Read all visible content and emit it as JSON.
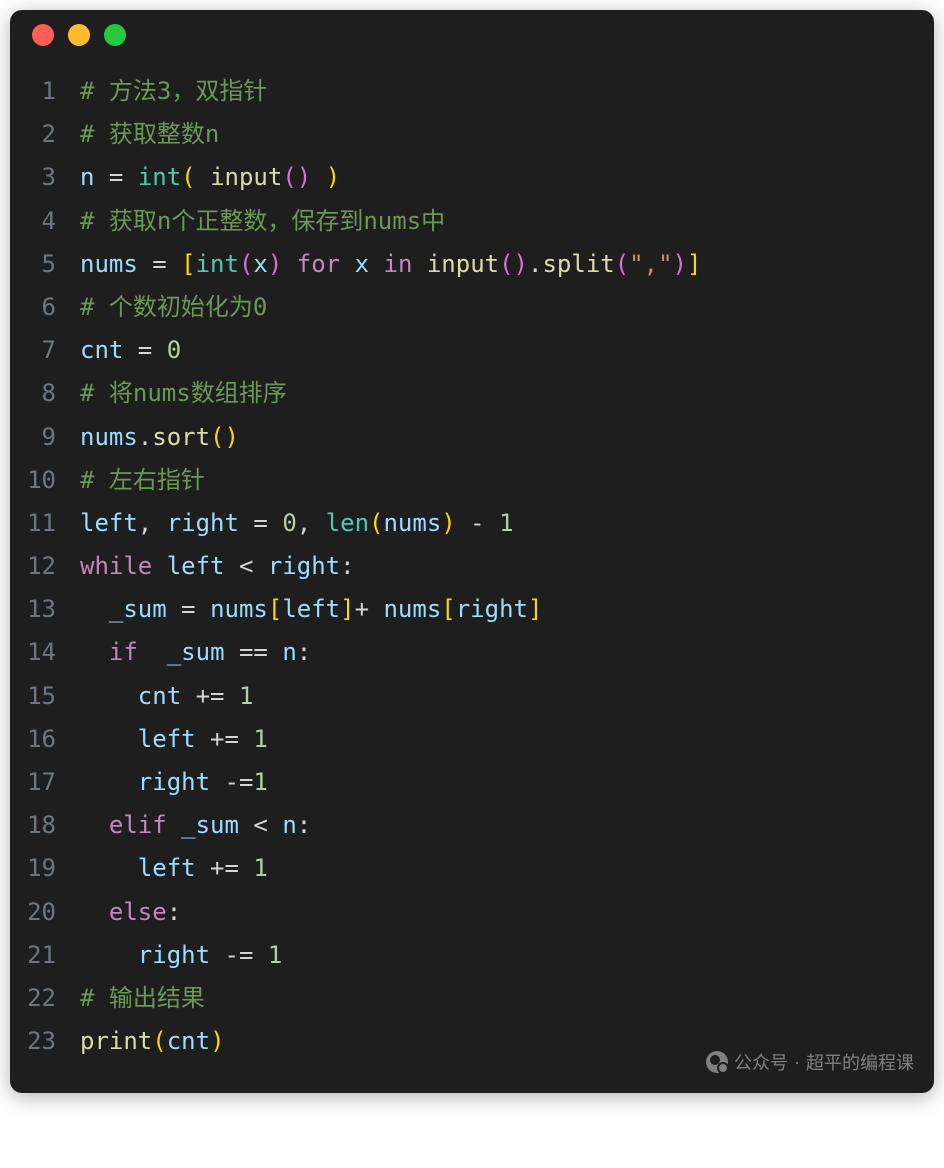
{
  "window": {
    "dots": [
      "red",
      "yellow",
      "green"
    ]
  },
  "watermark": {
    "label": "公众号",
    "sep": "·",
    "name": "超平的编程课"
  },
  "code": {
    "lines": [
      {
        "n": 1,
        "indent": "",
        "tokens": [
          {
            "t": "# 方法3，双指针",
            "c": "comment"
          }
        ]
      },
      {
        "n": 2,
        "indent": "",
        "tokens": [
          {
            "t": "# 获取整数n",
            "c": "comment"
          }
        ]
      },
      {
        "n": 3,
        "indent": "",
        "tokens": [
          {
            "t": "n",
            "c": "ident"
          },
          {
            "t": " = ",
            "c": "op"
          },
          {
            "t": "int",
            "c": "builtin"
          },
          {
            "t": "(",
            "c": "punc"
          },
          {
            "t": " ",
            "c": "op"
          },
          {
            "t": "input",
            "c": "func"
          },
          {
            "t": "()",
            "c": "punc2"
          },
          {
            "t": " ",
            "c": "op"
          },
          {
            "t": ")",
            "c": "punc"
          }
        ]
      },
      {
        "n": 4,
        "indent": "",
        "tokens": [
          {
            "t": "# 获取n个正整数，保存到nums中",
            "c": "comment"
          }
        ]
      },
      {
        "n": 5,
        "indent": "",
        "tokens": [
          {
            "t": "nums",
            "c": "ident"
          },
          {
            "t": " = ",
            "c": "op"
          },
          {
            "t": "[",
            "c": "punc"
          },
          {
            "t": "int",
            "c": "builtin"
          },
          {
            "t": "(",
            "c": "punc2"
          },
          {
            "t": "x",
            "c": "ident"
          },
          {
            "t": ")",
            "c": "punc2"
          },
          {
            "t": " ",
            "c": "op"
          },
          {
            "t": "for",
            "c": "keyword"
          },
          {
            "t": " ",
            "c": "op"
          },
          {
            "t": "x",
            "c": "ident"
          },
          {
            "t": " ",
            "c": "op"
          },
          {
            "t": "in",
            "c": "keyword"
          },
          {
            "t": " ",
            "c": "op"
          },
          {
            "t": "input",
            "c": "func"
          },
          {
            "t": "()",
            "c": "punc2"
          },
          {
            "t": ".",
            "c": "op"
          },
          {
            "t": "split",
            "c": "func"
          },
          {
            "t": "(",
            "c": "punc2"
          },
          {
            "t": "\",\"",
            "c": "string"
          },
          {
            "t": ")",
            "c": "punc2"
          },
          {
            "t": "]",
            "c": "punc"
          }
        ]
      },
      {
        "n": 6,
        "indent": "",
        "tokens": [
          {
            "t": "# 个数初始化为0",
            "c": "comment"
          }
        ]
      },
      {
        "n": 7,
        "indent": "",
        "tokens": [
          {
            "t": "cnt",
            "c": "ident"
          },
          {
            "t": " = ",
            "c": "op"
          },
          {
            "t": "0",
            "c": "number"
          }
        ]
      },
      {
        "n": 8,
        "indent": "",
        "tokens": [
          {
            "t": "# 将nums数组排序",
            "c": "comment"
          }
        ]
      },
      {
        "n": 9,
        "indent": "",
        "tokens": [
          {
            "t": "nums",
            "c": "ident"
          },
          {
            "t": ".",
            "c": "op"
          },
          {
            "t": "sort",
            "c": "func"
          },
          {
            "t": "()",
            "c": "punc"
          }
        ]
      },
      {
        "n": 10,
        "indent": "",
        "tokens": [
          {
            "t": "# 左右指针",
            "c": "comment"
          }
        ]
      },
      {
        "n": 11,
        "indent": "",
        "tokens": [
          {
            "t": "left",
            "c": "ident"
          },
          {
            "t": ", ",
            "c": "op"
          },
          {
            "t": "right",
            "c": "ident"
          },
          {
            "t": " = ",
            "c": "op"
          },
          {
            "t": "0",
            "c": "number"
          },
          {
            "t": ", ",
            "c": "op"
          },
          {
            "t": "len",
            "c": "builtin"
          },
          {
            "t": "(",
            "c": "punc"
          },
          {
            "t": "nums",
            "c": "ident"
          },
          {
            "t": ")",
            "c": "punc"
          },
          {
            "t": " - ",
            "c": "op"
          },
          {
            "t": "1",
            "c": "number"
          }
        ]
      },
      {
        "n": 12,
        "indent": "",
        "tokens": [
          {
            "t": "while",
            "c": "keyword"
          },
          {
            "t": " ",
            "c": "op"
          },
          {
            "t": "left",
            "c": "ident"
          },
          {
            "t": " < ",
            "c": "op"
          },
          {
            "t": "right",
            "c": "ident"
          },
          {
            "t": ":",
            "c": "op"
          }
        ]
      },
      {
        "n": 13,
        "indent": "  ",
        "tokens": [
          {
            "t": "_sum",
            "c": "ident"
          },
          {
            "t": " = ",
            "c": "op"
          },
          {
            "t": "nums",
            "c": "ident"
          },
          {
            "t": "[",
            "c": "punc"
          },
          {
            "t": "left",
            "c": "ident"
          },
          {
            "t": "]",
            "c": "punc"
          },
          {
            "t": "+ ",
            "c": "op"
          },
          {
            "t": "nums",
            "c": "ident"
          },
          {
            "t": "[",
            "c": "punc"
          },
          {
            "t": "right",
            "c": "ident"
          },
          {
            "t": "]",
            "c": "punc"
          }
        ]
      },
      {
        "n": 14,
        "indent": "  ",
        "tokens": [
          {
            "t": "if",
            "c": "keyword"
          },
          {
            "t": "  ",
            "c": "op"
          },
          {
            "t": "_sum",
            "c": "ident"
          },
          {
            "t": " == ",
            "c": "op"
          },
          {
            "t": "n",
            "c": "ident"
          },
          {
            "t": ":",
            "c": "op"
          }
        ]
      },
      {
        "n": 15,
        "indent": "    ",
        "tokens": [
          {
            "t": "cnt",
            "c": "ident"
          },
          {
            "t": " += ",
            "c": "op"
          },
          {
            "t": "1",
            "c": "number"
          }
        ]
      },
      {
        "n": 16,
        "indent": "    ",
        "tokens": [
          {
            "t": "left",
            "c": "ident"
          },
          {
            "t": " += ",
            "c": "op"
          },
          {
            "t": "1",
            "c": "number"
          }
        ]
      },
      {
        "n": 17,
        "indent": "    ",
        "tokens": [
          {
            "t": "right",
            "c": "ident"
          },
          {
            "t": " -=",
            "c": "op"
          },
          {
            "t": "1",
            "c": "number"
          }
        ]
      },
      {
        "n": 18,
        "indent": "  ",
        "tokens": [
          {
            "t": "elif",
            "c": "keyword"
          },
          {
            "t": " ",
            "c": "op"
          },
          {
            "t": "_sum",
            "c": "ident"
          },
          {
            "t": " < ",
            "c": "op"
          },
          {
            "t": "n",
            "c": "ident"
          },
          {
            "t": ":",
            "c": "op"
          }
        ]
      },
      {
        "n": 19,
        "indent": "    ",
        "tokens": [
          {
            "t": "left",
            "c": "ident"
          },
          {
            "t": " += ",
            "c": "op"
          },
          {
            "t": "1",
            "c": "number"
          }
        ]
      },
      {
        "n": 20,
        "indent": "  ",
        "tokens": [
          {
            "t": "else",
            "c": "keyword"
          },
          {
            "t": ":",
            "c": "op"
          }
        ]
      },
      {
        "n": 21,
        "indent": "    ",
        "tokens": [
          {
            "t": "right",
            "c": "ident"
          },
          {
            "t": " -= ",
            "c": "op"
          },
          {
            "t": "1",
            "c": "number"
          }
        ]
      },
      {
        "n": 22,
        "indent": "",
        "tokens": [
          {
            "t": "# 输出结果",
            "c": "comment"
          }
        ]
      },
      {
        "n": 23,
        "indent": "",
        "tokens": [
          {
            "t": "print",
            "c": "func"
          },
          {
            "t": "(",
            "c": "punc"
          },
          {
            "t": "cnt",
            "c": "ident"
          },
          {
            "t": ")",
            "c": "punc"
          }
        ]
      }
    ]
  }
}
